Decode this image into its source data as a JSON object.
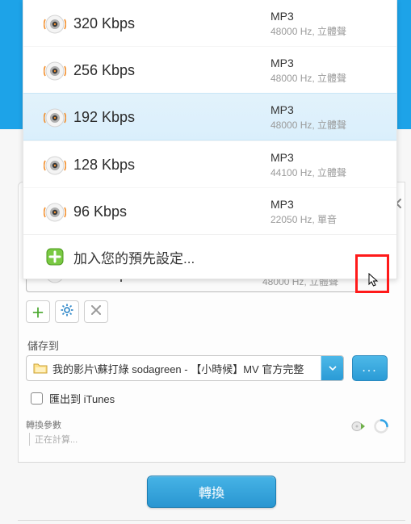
{
  "presets": [
    {
      "bitrate": "320 Kbps",
      "codec": "MP3",
      "sub": "48000 Hz, 立體聲",
      "selected": false
    },
    {
      "bitrate": "256 Kbps",
      "codec": "MP3",
      "sub": "48000 Hz, 立體聲",
      "selected": false
    },
    {
      "bitrate": "192 Kbps",
      "codec": "MP3",
      "sub": "48000 Hz, 立體聲",
      "selected": true
    },
    {
      "bitrate": "128 Kbps",
      "codec": "MP3",
      "sub": "44100 Hz, 立體聲",
      "selected": false
    },
    {
      "bitrate": "96 Kbps",
      "codec": "MP3",
      "sub": "22050 Hz, 單音",
      "selected": false
    }
  ],
  "add_preset_label": "加入您的預先設定...",
  "selected_preset": {
    "bitrate": "192 Kbps",
    "codec": "MP3",
    "sub": "48000 Hz, 立體聲"
  },
  "save_to_label": "儲存到",
  "save_path": "我的影片\\蘇打綠 sodagreen - 【小時候】MV 官方完整",
  "browse_label": "...",
  "export_itunes_label": "匯出到 iTunes",
  "export_itunes_checked": false,
  "params_label": "轉換參數",
  "params_status": "正在計算...",
  "convert_label": "轉換"
}
